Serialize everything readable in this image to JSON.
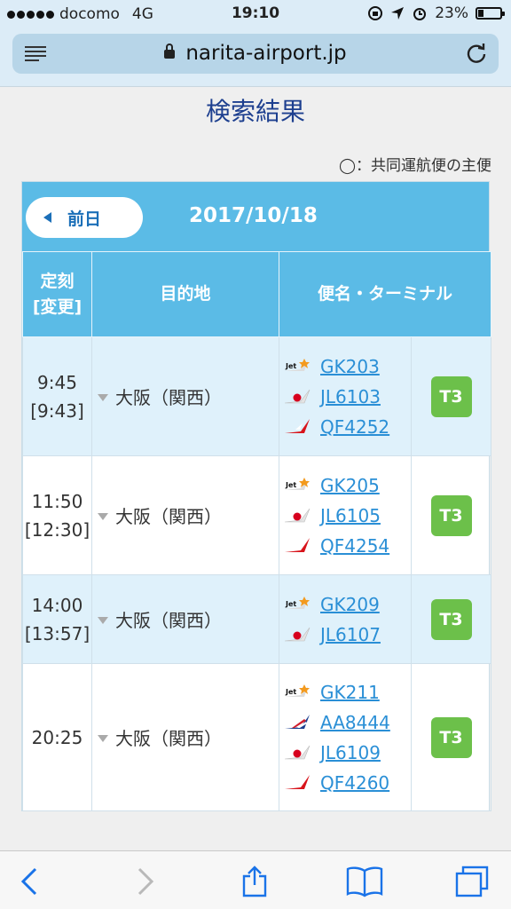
{
  "status": {
    "carrier": "docomo",
    "network": "4G",
    "time": "19:10",
    "battery": "23%",
    "battery_level": 0.23
  },
  "browser": {
    "url": "narita-airport.jp"
  },
  "page": {
    "title": "検索結果",
    "legend": "◯：共同運航便の主便",
    "prev_label": "前日",
    "date": "2017/10/18",
    "headers": {
      "time_line1": "定刻",
      "time_line2": "[変更]",
      "destination": "目的地",
      "flight_terminal": "便名・ターミナル"
    },
    "rows": [
      {
        "time": "9:45",
        "changed": "[9:43]",
        "destination": "大阪（関西）",
        "terminal": "T3",
        "flights": [
          {
            "code": "GK203",
            "airline": "jetstar"
          },
          {
            "code": "JL6103",
            "airline": "jal"
          },
          {
            "code": "QF4252",
            "airline": "qantas"
          }
        ]
      },
      {
        "time": "11:50",
        "changed": "[12:30]",
        "destination": "大阪（関西）",
        "terminal": "T3",
        "flights": [
          {
            "code": "GK205",
            "airline": "jetstar"
          },
          {
            "code": "JL6105",
            "airline": "jal"
          },
          {
            "code": "QF4254",
            "airline": "qantas"
          }
        ]
      },
      {
        "time": "14:00",
        "changed": "[13:57]",
        "destination": "大阪（関西）",
        "terminal": "T3",
        "flights": [
          {
            "code": "GK209",
            "airline": "jetstar"
          },
          {
            "code": "JL6107",
            "airline": "jal"
          }
        ]
      },
      {
        "time": "20:25",
        "changed": "",
        "destination": "大阪（関西）",
        "terminal": "T3",
        "flights": [
          {
            "code": "GK211",
            "airline": "jetstar"
          },
          {
            "code": "AA8444",
            "airline": "american"
          },
          {
            "code": "JL6109",
            "airline": "jal"
          },
          {
            "code": "QF4260",
            "airline": "qantas"
          }
        ]
      }
    ]
  },
  "icons": {
    "menu": "menu-icon",
    "lock": "lock-icon",
    "reload": "reload-icon",
    "back": "back-arrow-icon",
    "forward": "forward-arrow-icon",
    "share": "share-icon",
    "bookmarks": "bookmarks-icon",
    "tabs": "tabs-icon"
  }
}
